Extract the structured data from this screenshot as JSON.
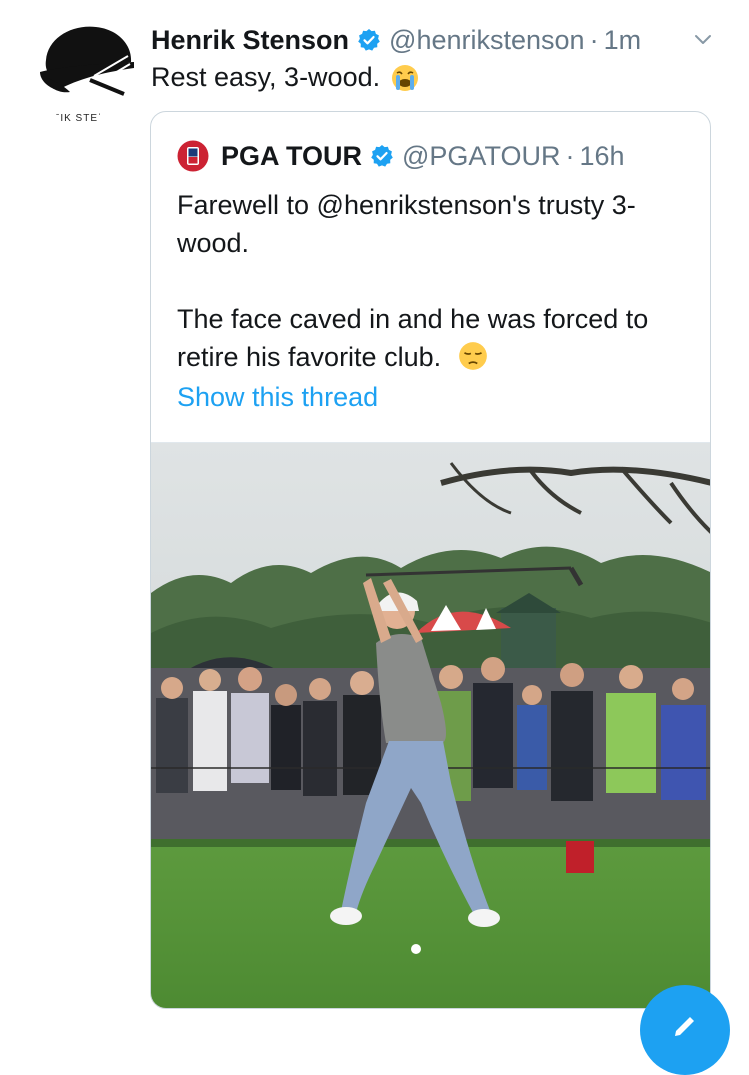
{
  "tweet": {
    "author_name": "Henrik Stenson",
    "author_handle": "@henrikstenson",
    "separator": "·",
    "time": "1m",
    "text": "Rest easy, 3-wood.",
    "avatar_caption": "ˉIK STEˈ",
    "emoji": "loudly-crying-face-emoji"
  },
  "quoted": {
    "author_name": "PGA TOUR",
    "author_handle": "@PGATOUR",
    "separator": "·",
    "time": "16h",
    "line1": "Farewell to @henrikstenson's trusty 3-wood.",
    "line2": "The face caved in and he was forced to retire his favorite club.",
    "emoji": "pensive-face-emoji",
    "show_thread": "Show this thread",
    "media_alt": "golfer-backswing-video-frame"
  },
  "colors": {
    "link": "#1da1f2",
    "secondary_text": "#657786",
    "border": "#ccd6dd",
    "primary_text": "#14171a"
  }
}
